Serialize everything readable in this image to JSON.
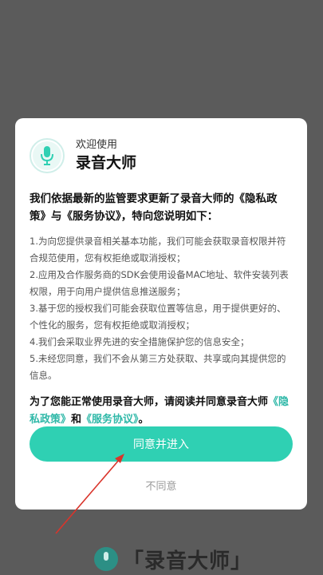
{
  "background": {
    "brand_text": "「录音大师」"
  },
  "dialog": {
    "welcome": "欢迎使用",
    "app_name": "录音大师",
    "intro": "我们依据最新的监管要求更新了录音大师的《隐私政策》与《服务协议》，特向您说明如下：",
    "items": [
      "1.为向您提供录音相关基本功能，我们可能会获取录音权限并符合规范使用，您有权拒绝或取消授权；",
      "2.应用及合作服务商的SDK会使用设备MAC地址、软件安装列表权限，用于向用户提供信息推送服务；",
      "3.基于您的授权我们可能会获取位置等信息，用于提供更好的、个性化的服务，您有权拒绝或取消授权；",
      "4.我们会采取业界先进的安全措施保护您的信息安全；",
      "5.未经您同意，我们不会从第三方处获取、共享或向其提供您的信息。"
    ],
    "closing_prefix": "为了您能正常使用录音大师，请阅读并同意录音大师",
    "privacy_link": "《隐私政策》",
    "closing_and": "和",
    "service_link": "《服务协议》",
    "closing_suffix": "。",
    "agree_label": "同意并进入",
    "disagree_label": "不同意"
  },
  "colors": {
    "accent": "#2fd0b3",
    "link": "#2fb8a8",
    "overlay": "#5b5b5b",
    "annotation_arrow": "#d9342b"
  },
  "icons": {
    "logo": "microphone-icon"
  }
}
